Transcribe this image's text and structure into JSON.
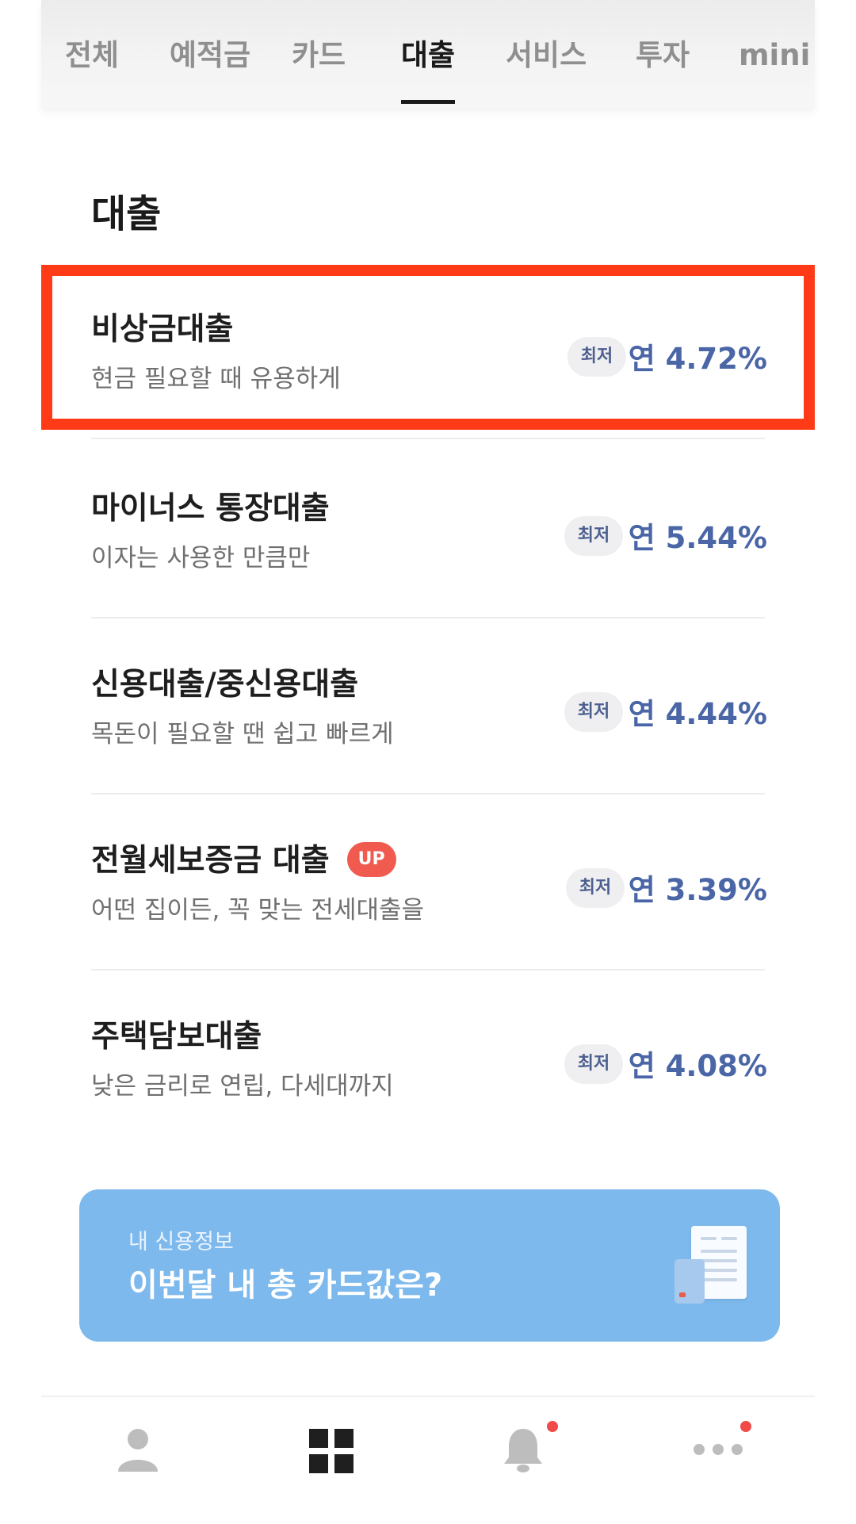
{
  "tabs": [
    {
      "label": "전체",
      "active": false
    },
    {
      "label": "예적금",
      "active": false
    },
    {
      "label": "카드",
      "active": false
    },
    {
      "label": "대출",
      "active": true
    },
    {
      "label": "서비스",
      "active": false
    },
    {
      "label": "투자",
      "active": false
    },
    {
      "label": "mini",
      "active": false
    }
  ],
  "section": {
    "title": "대출"
  },
  "loans": [
    {
      "title": "비상금대출",
      "subtitle": "현금 필요할 때 유용하게",
      "badge": "최저",
      "rate": "연 4.72%",
      "highlighted": true
    },
    {
      "title": "마이너스 통장대출",
      "subtitle": "이자는 사용한 만큼만",
      "badge": "최저",
      "rate": "연 5.44%"
    },
    {
      "title": "신용대출/중신용대출",
      "subtitle": "목돈이 필요할 땐 쉽고 빠르게",
      "badge": "최저",
      "rate": "연 4.44%"
    },
    {
      "title": "전월세보증금 대출",
      "subtitle": "어떤 집이든, 꼭 맞는 전세대출을",
      "badge": "최저",
      "rate": "연 3.39%",
      "tag": "UP"
    },
    {
      "title": "주택담보대출",
      "subtitle": "낮은 금리로 연립, 다세대까지",
      "badge": "최저",
      "rate": "연 4.08%"
    }
  ],
  "banner": {
    "kicker": "내 신용정보",
    "headline": "이번달 내 총 카드값은?"
  },
  "colors": {
    "accent_rate": "#4a66a6",
    "highlight": "#ff3a16",
    "banner": "#7db9ec",
    "up_badge": "#f05a4f",
    "notification_dot": "#f04a4a"
  },
  "bottom_nav": [
    {
      "icon": "person-icon"
    },
    {
      "icon": "grid-icon",
      "active": true
    },
    {
      "icon": "bell-icon",
      "has_badge": true
    },
    {
      "icon": "more-icon",
      "has_badge": true
    }
  ]
}
